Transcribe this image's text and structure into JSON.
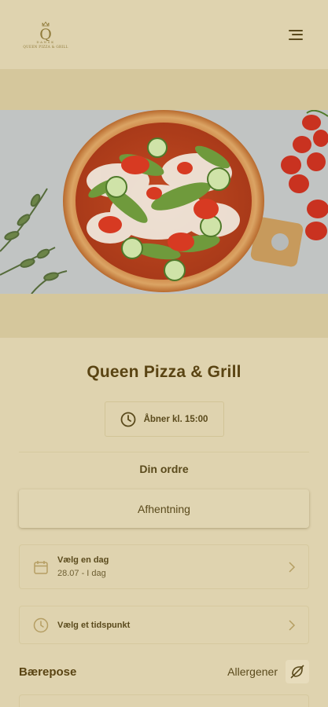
{
  "header": {
    "logo_letter": "Q",
    "logo_crown_text": "DANSK",
    "logo_text": "QUEEN PIZZA & GRILL",
    "menu_icon": "hamburger-menu-icon"
  },
  "hero": {
    "image": "pizza-photo",
    "alt": ""
  },
  "restaurant": {
    "name": "Queen Pizza & Grill",
    "opening_text": "Åbner kl. 15:00",
    "clock_icon": "clock-icon"
  },
  "order": {
    "heading": "Din ordre",
    "pickup_label": "Afhentning",
    "day": {
      "label": "Vælg en dag",
      "value": "28.07 - I dag",
      "icon": "calendar-icon"
    },
    "time": {
      "label": "Vælg et tidspunkt",
      "icon": "clock-icon"
    }
  },
  "footer": {
    "bag_label": "Bærepose",
    "allergen_label": "Allergener",
    "allergen_icon": "allergen-icon"
  },
  "colors": {
    "background": "#dfd3af",
    "band": "#d5c79c",
    "text": "#5a4a1c",
    "title": "#5a4413"
  }
}
